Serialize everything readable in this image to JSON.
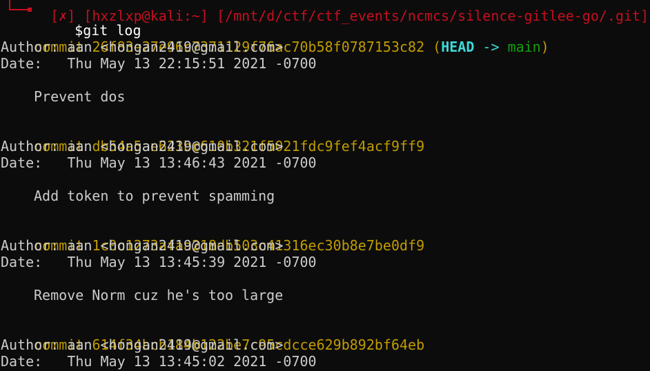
{
  "prompt": {
    "top_fragment": "[✗] [hxzlxp@kali:~] [/mnt/d/ctf/ctf_events/ncmcs/silence-gitlee-go/.git]",
    "symbol": "$",
    "command": "git log"
  },
  "commits": [
    {
      "keyword": "commit",
      "hash": "26f83e27e96c7371129f76ac70b58f0787153c82",
      "ref_open": "(",
      "ref_head": "HEAD",
      "ref_arrow": "->",
      "ref_branch": "main",
      "ref_close": ")",
      "author_label": "Author:",
      "author": "aan <hongan2419@gmail.com>",
      "date_label": "Date:",
      "date": "Thu May 13 22:15:51 2021 -0700",
      "message": "Prevent dos"
    },
    {
      "keyword": "commit",
      "hash": "db54a5ae623bc610b321f5021fdc9fef4acf9ff9",
      "author_label": "Author:",
      "author": "aan <hongan2419@gmail.com>",
      "date_label": "Date:",
      "date": "Thu May 13 13:46:43 2021 -0700",
      "message": "Add token to prevent spamming"
    },
    {
      "keyword": "commit",
      "hash": "1c0c1273afaa218db503c41316ec30b8e7be0df9",
      "author_label": "Author:",
      "author": "aan <hongan2419@gmail.com>",
      "date_label": "Date:",
      "date": "Thu May 13 13:45:39 2021 -0700",
      "message": "Remove Norm cuz he's too large"
    },
    {
      "keyword": "commit",
      "hash": "614f34bcb184b122be7c95cdcce629b892bf64eb",
      "author_label": "Author:",
      "author": "aan <hongan2419@gmail.com>",
      "date_label": "Date:",
      "date": "Thu May 13 13:45:02 2021 -0700"
    }
  ],
  "colors": {
    "background": "#0c0c0c",
    "text": "#cccccc",
    "commit_yellow": "#c19c00",
    "head_cyan": "#3ed8d8",
    "branch_green": "#13a10e",
    "prompt_red": "#c50f1f"
  }
}
